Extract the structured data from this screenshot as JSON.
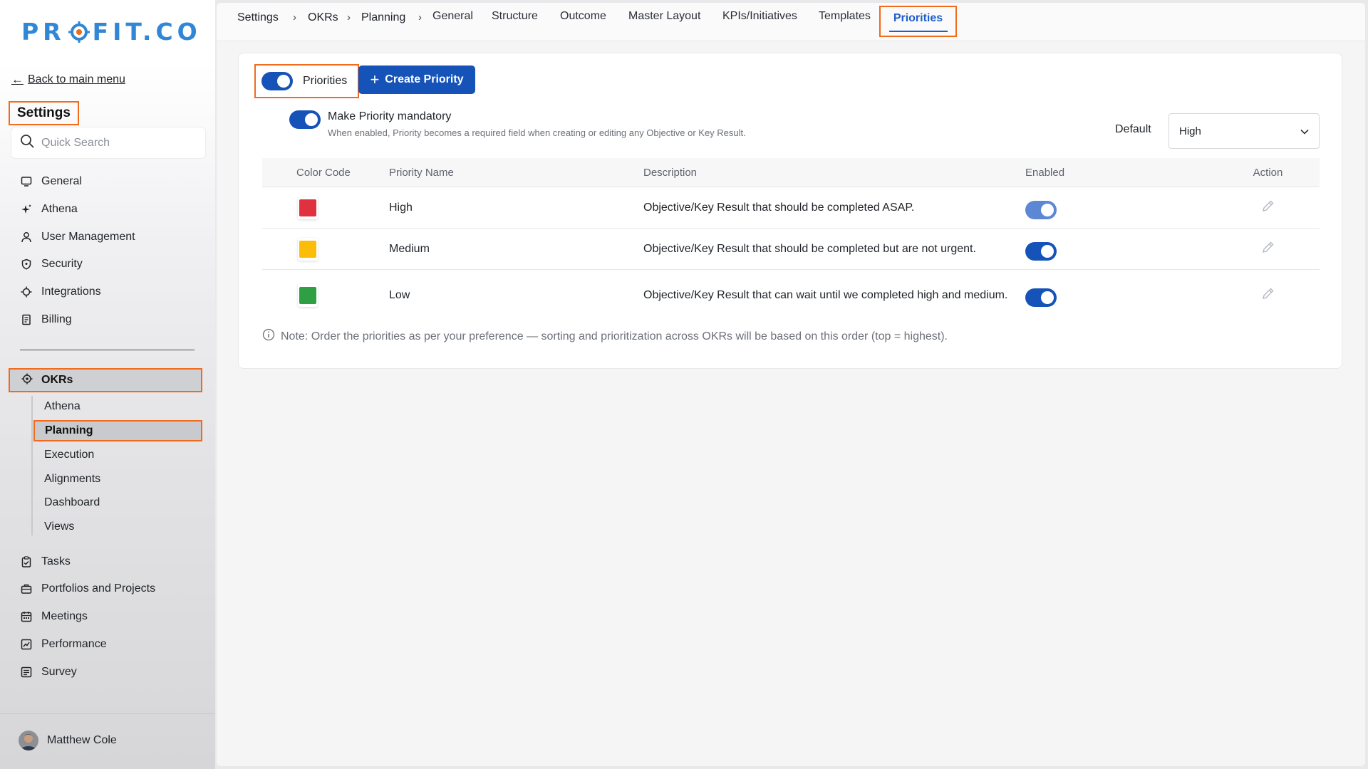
{
  "brand": {
    "logo_left": "PR",
    "logo_right": "FIT.CO",
    "accent": "#f26a1b",
    "primary": "#1553b8"
  },
  "sidebar": {
    "back_label": "Back to main menu",
    "title": "Settings",
    "search_placeholder": "Quick Search",
    "items": [
      {
        "label": "General",
        "icon": "monitor-icon"
      },
      {
        "label": "Athena",
        "icon": "sparkle-icon"
      },
      {
        "label": "User Management",
        "icon": "user-icon"
      },
      {
        "label": "Security",
        "icon": "shield-icon"
      },
      {
        "label": "Integrations",
        "icon": "plug-icon"
      },
      {
        "label": "Billing",
        "icon": "receipt-icon"
      }
    ],
    "okrs_label": "OKRs",
    "okrs_sub": [
      "Athena",
      "Planning",
      "Execution",
      "Alignments",
      "Dashboard",
      "Views"
    ],
    "lower_items": [
      {
        "label": "Tasks",
        "icon": "clipboard-check-icon"
      },
      {
        "label": "Portfolios and Projects",
        "icon": "briefcase-icon"
      },
      {
        "label": "Meetings",
        "icon": "calendar-icon"
      },
      {
        "label": "Performance",
        "icon": "chart-icon"
      },
      {
        "label": "Survey",
        "icon": "survey-icon"
      }
    ],
    "user_name": "Matthew Cole"
  },
  "topnav": {
    "breadcrumbs": [
      "Settings",
      "OKRs",
      "Planning"
    ],
    "separator": "›",
    "tabs": [
      "General",
      "Structure",
      "Outcome",
      "Master Layout",
      "KPIs/Initiatives",
      "Templates",
      "Priorities"
    ],
    "active_tab": "Priorities"
  },
  "priorities": {
    "toggle_label": "Priorities",
    "toggle_on": true,
    "create_label": "Create Priority",
    "mandatory_label": "Make Priority mandatory",
    "mandatory_help": "When enabled, Priority becomes a required field when creating or editing any Objective or Key Result.",
    "mandatory_on": true,
    "default_label": "Default",
    "default_value": "High",
    "columns": [
      "Color Code",
      "Priority Name",
      "Description",
      "Enabled",
      "Action"
    ],
    "rows": [
      {
        "color": "#e0323e",
        "name": "High",
        "description": "Objective/Key Result that should be completed ASAP.",
        "enabled": true
      },
      {
        "color": "#fbbd08",
        "name": "Medium",
        "description": "Objective/Key Result that should be completed but are not urgent.",
        "enabled": true
      },
      {
        "color": "#2ea043",
        "name": "Low",
        "description": "Objective/Key Result that can wait until we completed high and medium.",
        "enabled": true
      }
    ],
    "note": "Note: Order the priorities as per your preference — sorting and prioritization across OKRs will be based on this order (top = highest)."
  }
}
